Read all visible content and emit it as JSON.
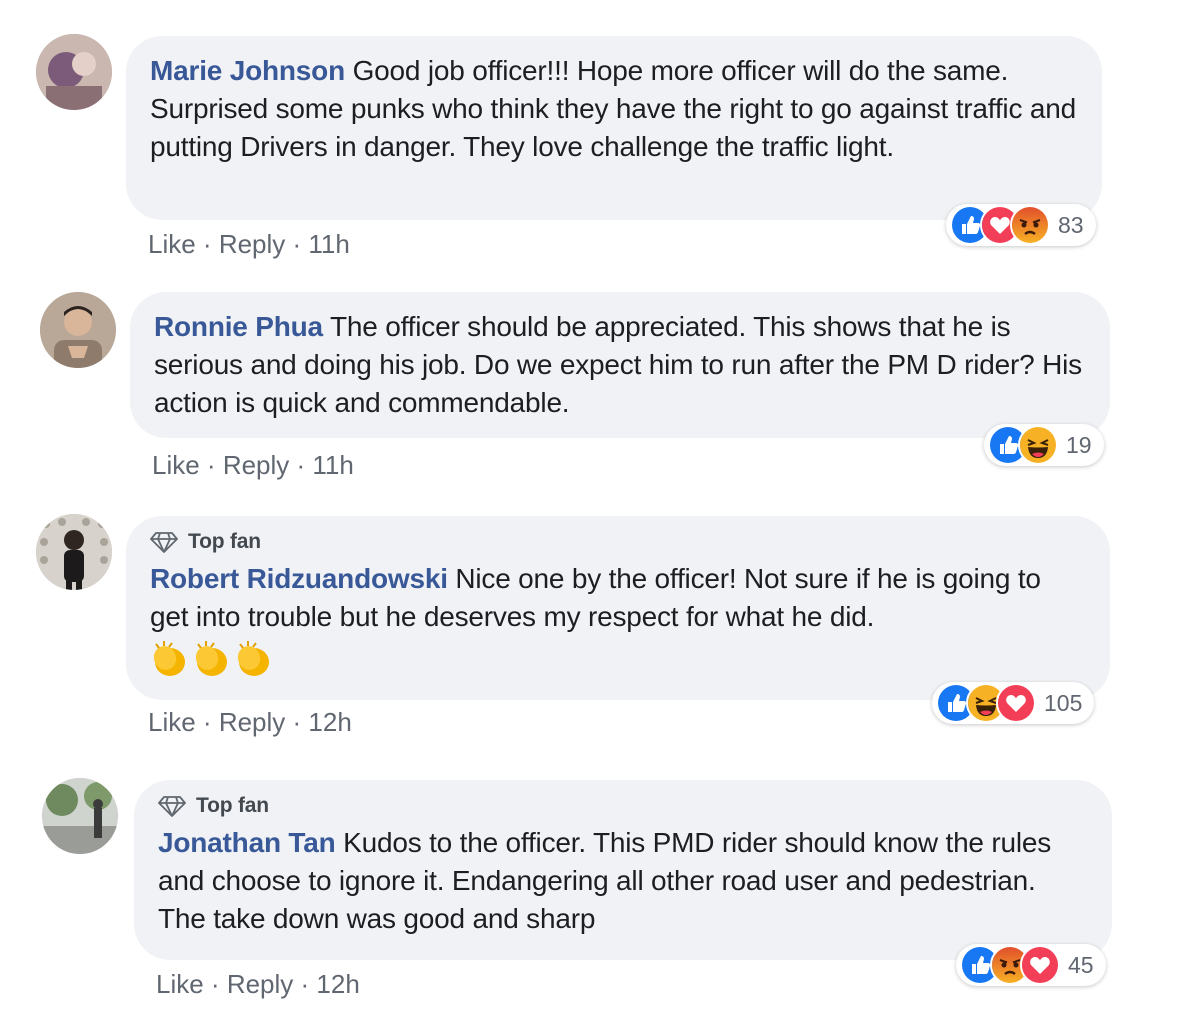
{
  "comments": [
    {
      "author": "Marie Johnson",
      "text": " Good job officer!!! Hope more officer will do the same. Surprised some punks who think they have the right to go against traffic and putting Drivers in danger. They love challenge the traffic light.",
      "actions": {
        "like": "Like",
        "reply": "Reply",
        "sep": " · ",
        "time": "11h"
      },
      "reaction_icons": [
        "like-icon",
        "love-icon",
        "angry-icon"
      ],
      "reaction_count": "83"
    },
    {
      "author": "Ronnie Phua",
      "text": " The officer should be appreciated. This shows that he is serious and doing his job. Do we expect him to run after the PM D rider? His action is quick and commendable.",
      "actions": {
        "like": "Like",
        "reply": "Reply",
        "sep": " · ",
        "time": "11h"
      },
      "reaction_icons": [
        "like-icon",
        "haha-icon"
      ],
      "reaction_count": "19"
    },
    {
      "badge": "Top fan",
      "author": "Robert Ridzuandowski",
      "text": " Nice one by the officer! Not sure if he is going to get into trouble but he deserves my respect for what he did.",
      "emoji": [
        "clapping-hands-emoji",
        "clapping-hands-emoji",
        "clapping-hands-emoji"
      ],
      "actions": {
        "like": "Like",
        "reply": "Reply",
        "sep": " · ",
        "time": "12h"
      },
      "reaction_icons": [
        "like-icon",
        "haha-icon",
        "love-icon"
      ],
      "reaction_count": "105"
    },
    {
      "badge": "Top fan",
      "author": "Jonathan Tan",
      "text": " Kudos to the officer. This PMD rider should know the rules and choose to ignore it. Endangering all other road user and pedestrian. The take down was good and sharp",
      "actions": {
        "like": "Like",
        "reply": "Reply",
        "sep": " · ",
        "time": "12h"
      },
      "reaction_icons": [
        "like-icon",
        "angry-icon",
        "love-icon"
      ],
      "reaction_count": "45"
    }
  ],
  "colors": {
    "author": "#385898",
    "bubble": "#f0f2f5",
    "meta": "#606770",
    "like": "#1877f2",
    "love": "#f33e58",
    "haha": "#f7b125",
    "angry": "#e9710f"
  }
}
